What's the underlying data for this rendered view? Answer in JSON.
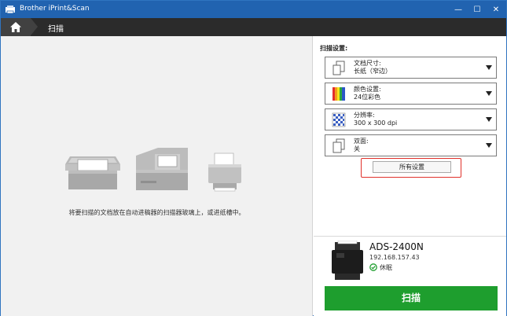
{
  "window": {
    "title": "Brother iPrint&Scan",
    "min_glyph": "—",
    "max_glyph": "☐",
    "close_glyph": "✕"
  },
  "nav": {
    "title": "扫描"
  },
  "main": {
    "instruction": "将要扫描的文档放在自动进稿器的扫描器玻璃上，或进纸槽中。"
  },
  "settings": {
    "header": "扫描设置:",
    "items": [
      {
        "label": "文档尺寸:",
        "value": "长纸（窄边）",
        "icon": "document-size-icon"
      },
      {
        "label": "颜色设置:",
        "value": "24位彩色",
        "icon": "color-icon"
      },
      {
        "label": "分辨率:",
        "value": "300 x 300 dpi",
        "icon": "resolution-icon"
      },
      {
        "label": "双面:",
        "value": "关",
        "icon": "duplex-icon"
      }
    ],
    "all_settings_label": "所有设置"
  },
  "device": {
    "name": "ADS-2400N",
    "ip": "192.168.157.43",
    "status": "休眠"
  },
  "scan_button_label": "扫描",
  "colors": {
    "titlebar": "#2163b0",
    "navbar": "#2b2b2b",
    "scan_button": "#1e9e2e",
    "highlight": "#e0302a",
    "status_ok": "#1e9e2e"
  }
}
